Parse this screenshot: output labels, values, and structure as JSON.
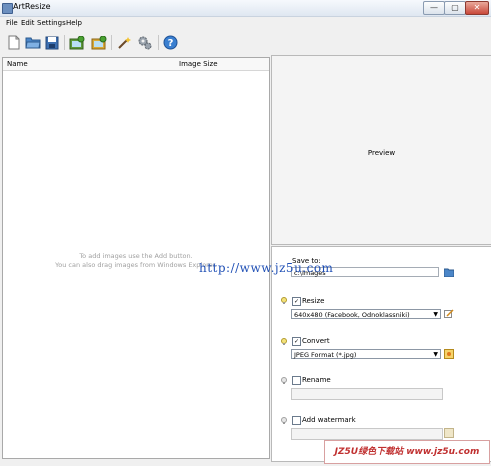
{
  "window": {
    "title": "ArtResize",
    "minimize": "—",
    "maximize": "▢",
    "close": "✕"
  },
  "menu": [
    "File",
    "Edit",
    "Settings",
    "Help"
  ],
  "toolbar": {
    "icons": [
      "new-file-icon",
      "open-folder-icon",
      "save-icon",
      "add-images-icon",
      "add-folder-icon",
      "magic-wand-icon",
      "settings-gears-icon",
      "help-icon"
    ],
    "help_glyph": "?"
  },
  "list": {
    "columns": [
      "Name",
      "Image Size"
    ],
    "empty_line1": "To add images use the Add button.",
    "empty_line2": "You can also drag images from Windows Explorer."
  },
  "preview": {
    "label": "Preview"
  },
  "settings": {
    "save_to": {
      "label": "Save to:",
      "value": "c:\\Images"
    },
    "resize": {
      "label": "Resize",
      "checked": true,
      "check_glyph": "✓",
      "option": "640x480 (Facebook, Odnoklassniki)"
    },
    "convert": {
      "label": "Convert",
      "checked": true,
      "check_glyph": "✓",
      "option": "JPEG Format (*.jpg)"
    },
    "rename": {
      "label": "Rename",
      "checked": false,
      "value": ""
    },
    "watermark": {
      "label": "Add watermark",
      "checked": false,
      "value": ""
    },
    "dropdown_arrow": "▼"
  },
  "overlays": {
    "url": "http://www.jz5u.com",
    "banner": "JZ5U绿色下载站 www.jz5u.com"
  },
  "colors": {
    "accent": "#3a6fb0",
    "titlebar": "#dfe7f1",
    "watermark_url": "#1f4fb5",
    "banner_text": "#c03030"
  }
}
